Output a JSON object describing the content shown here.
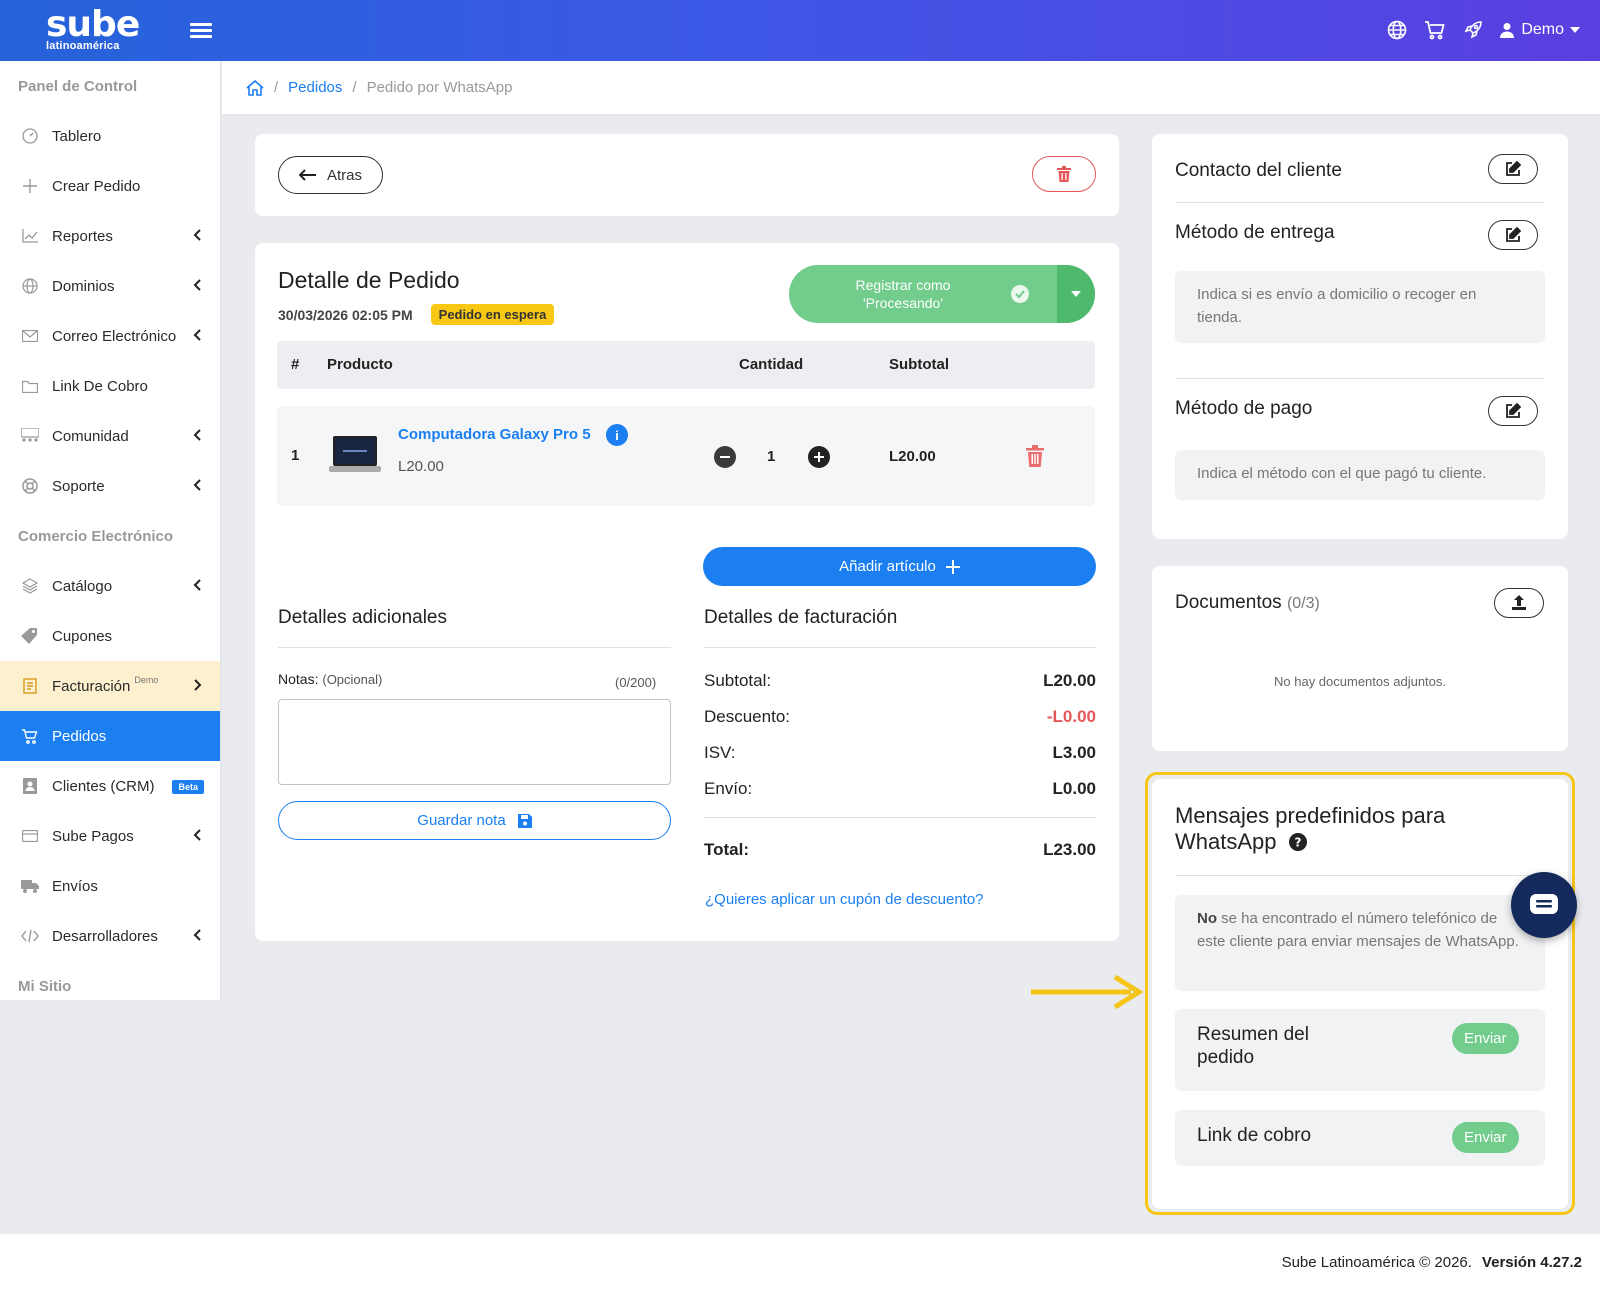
{
  "brand": {
    "logo_main": "sube",
    "logo_sub": "latinoamérica"
  },
  "topbar": {
    "user_name": "Demo"
  },
  "sidebar": {
    "sections": [
      "Panel de Control",
      "Comercio Electrónico",
      "Mi Sitio"
    ],
    "items": [
      {
        "label": "Tablero"
      },
      {
        "label": "Crear Pedido"
      },
      {
        "label": "Reportes"
      },
      {
        "label": "Dominios"
      },
      {
        "label": "Correo Electrónico"
      },
      {
        "label": "Link De Cobro"
      },
      {
        "label": "Comunidad"
      },
      {
        "label": "Soporte"
      },
      {
        "label": "Catálogo"
      },
      {
        "label": "Cupones"
      },
      {
        "label": "Facturación",
        "sup": "Demo"
      },
      {
        "label": "Pedidos"
      },
      {
        "label": "Clientes (CRM)",
        "badge": "Beta"
      },
      {
        "label": "Sube Pagos"
      },
      {
        "label": "Envíos"
      },
      {
        "label": "Desarrolladores"
      }
    ]
  },
  "breadcrumb": {
    "level1": "Pedidos",
    "sep": "/",
    "current": "Pedido por WhatsApp"
  },
  "actions": {
    "back_label": "Atras"
  },
  "order": {
    "title": "Detalle de Pedido",
    "datetime": "30/03/2026 02:05 PM",
    "status": "Pedido en espera",
    "register_line1": "Registrar como",
    "register_line2": "'Procesando'",
    "table_headers": {
      "num": "#",
      "product": "Producto",
      "qty": "Cantidad",
      "subtotal": "Subtotal"
    },
    "items": [
      {
        "num": "1",
        "name": "Computadora Galaxy Pro 5",
        "price": "L20.00",
        "qty": "1",
        "subtotal": "L20.00"
      }
    ],
    "add_item_label": "Añadir artículo"
  },
  "additional": {
    "title": "Detalles adicionales",
    "notes_label": "Notas:",
    "notes_optional": "(Opcional)",
    "notes_count": "(0/200)",
    "notes_value": "",
    "save_note_label": "Guardar nota"
  },
  "billing": {
    "title": "Detalles de facturación",
    "subtotal_label": "Subtotal:",
    "subtotal": "L20.00",
    "discount_label": "Descuento:",
    "discount": "-L0.00",
    "tax_label": "ISV:",
    "tax": "L3.00",
    "shipping_label": "Envío:",
    "shipping": "L0.00",
    "total_label": "Total:",
    "total": "L23.00",
    "coupon_link": "¿Quieres aplicar un cupón de descuento?"
  },
  "customer": {
    "contact_title": "Contacto del cliente",
    "delivery_title": "Método de entrega",
    "delivery_hint": "Indica si es envío a domicilio o recoger en tienda.",
    "payment_title": "Método de pago",
    "payment_hint": "Indica el método con el que pagó tu cliente."
  },
  "documents": {
    "title": "Documentos",
    "count": "(0/3)",
    "empty": "No hay documentos adjuntos."
  },
  "whatsapp": {
    "title_line1": "Mensajes predefinidos para",
    "title_line2": "WhatsApp",
    "warning_bold": "No",
    "warning_rest": " se ha encontrado el número telefónico de este cliente para enviar mensajes de WhatsApp.",
    "templates": [
      {
        "line1": "Resumen del",
        "line2": "pedido",
        "button": "Enviar"
      },
      {
        "line1": "Link de cobro",
        "line2": "",
        "button": "Enviar"
      }
    ]
  },
  "colors": {
    "accent": "#1b7ff2",
    "highlight": "#f5c518",
    "success": "#72cc8c",
    "danger": "#e35757"
  },
  "footer": {
    "copyright": "Sube Latinoamérica © 2026.",
    "version": "Versión 4.27.2"
  }
}
